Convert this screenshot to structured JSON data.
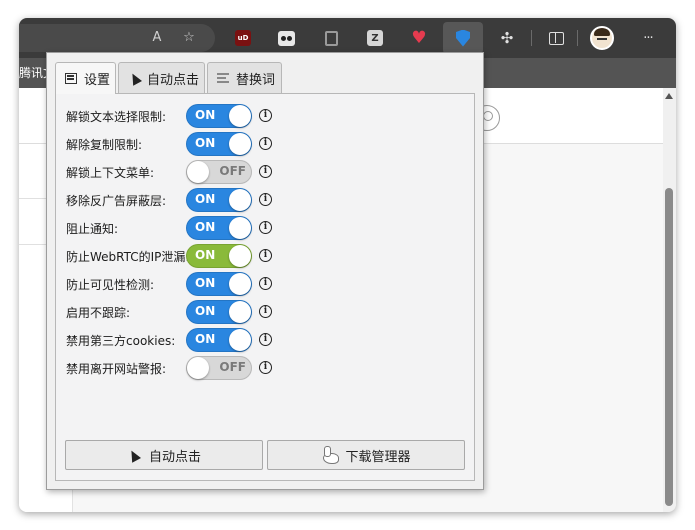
{
  "browser": {
    "page_tab_text": "腾讯文",
    "toolbar_icons": {
      "read_aloud": "read-aloud-icon",
      "favorite_add": "favorite-add-icon",
      "extensions": "puzzle-icon",
      "split_screen": "split-screen-icon",
      "more": "more-icon"
    },
    "read_aloud_glyph": "A",
    "more_glyph": "···",
    "ublock_glyph": "uD"
  },
  "popup": {
    "tabs": [
      {
        "label": "设置",
        "icon": "settings-icon",
        "active": true
      },
      {
        "label": "自动点击",
        "icon": "cursor-icon",
        "active": false
      },
      {
        "label": "替换词",
        "icon": "lines-icon",
        "active": false
      }
    ],
    "settings": [
      {
        "label": "解锁文本选择限制:",
        "state": "ON"
      },
      {
        "label": "解除复制限制:",
        "state": "ON"
      },
      {
        "label": "解锁上下文菜单:",
        "state": "OFF"
      },
      {
        "label": "移除反广告屏蔽层:",
        "state": "ON"
      },
      {
        "label": "阻止通知:",
        "state": "ON"
      },
      {
        "label": "防止WebRTC的IP泄漏:",
        "state": "ON"
      },
      {
        "label": "防止可见性检测:",
        "state": "ON"
      },
      {
        "label": "启用不跟踪:",
        "state": "ON"
      },
      {
        "label": "禁用第三方cookies:",
        "state": "ON"
      },
      {
        "label": "禁用离开网站警报:",
        "state": "OFF"
      }
    ],
    "info_glyph": "i",
    "buttons": {
      "auto_click": "自动点击",
      "download_manager": "下载管理器"
    }
  },
  "colors": {
    "toggle_on": "#2a86e0",
    "toggle_on_alt": "#8aba3a",
    "toggle_off": "#d8d8d8"
  }
}
